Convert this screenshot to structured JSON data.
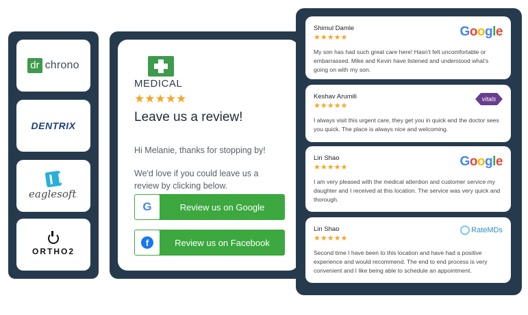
{
  "integrations": [
    {
      "id": "drchrono",
      "prefix": "dr",
      "suffix": "chrono"
    },
    {
      "id": "dentrix",
      "name": "DENTRIX"
    },
    {
      "id": "eaglesoft",
      "name": "eaglesoft",
      "dot": "."
    },
    {
      "id": "ortho2",
      "name": "ORTHO2"
    }
  ],
  "request": {
    "logo_text": "MEDICAL",
    "stars": "★★★★★",
    "title": "Leave us a review!",
    "greeting": "Hi Melanie, thanks for stopping by!",
    "message": "We'd love if you could leave us a review by clicking below.",
    "google_button": "Review us on Google",
    "facebook_button": "Review us on Facebook",
    "google_icon": "G",
    "facebook_icon": "f"
  },
  "reviews": [
    {
      "name": "Shimul Damle",
      "stars": "★★★★★",
      "source": "Google",
      "text": "My son has had such great care here! Hasn't felt uncomfortable or embarrassed. Mike and Kevin have listened and understood what's going on with my son."
    },
    {
      "name": "Keshav Arumili",
      "stars": "★★★★★",
      "source": "vitals",
      "text": "I always visit this urgent care, they get you in quick and the doctor sees you quick. The place is always nice and welcoming."
    },
    {
      "name": "Lin Shao",
      "stars": "★★★★★",
      "source": "Google",
      "text": "I am very pleased with the medical attention and customer service my daughter and I received at this location. The service was very quick and thorough."
    },
    {
      "name": "Lin Shao",
      "stars": "★★★★★",
      "source": "RateMDs",
      "text": "Second time I have been to this location and have had a positive experience and would recommend. The end to end process is very convenient and I like being able to schedule an appointment."
    }
  ],
  "colors": {
    "panel": "#263a4e",
    "button_green": "#3ca83f",
    "star": "#f5a623",
    "google_blue": "#4285f4",
    "google_red": "#ea4335",
    "google_yellow": "#fbbc05",
    "google_green": "#34a853"
  }
}
